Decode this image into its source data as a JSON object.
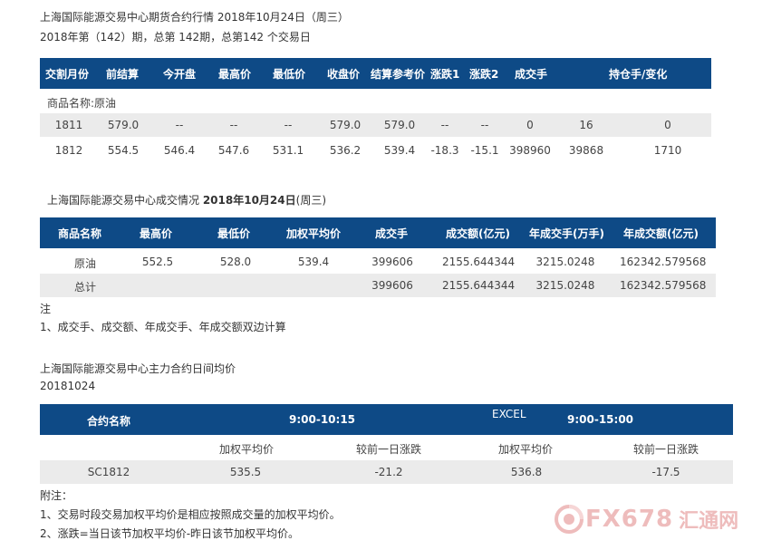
{
  "section1": {
    "title": "上海国际能源交易中心期货合约行情 2018年10月24日（周三）",
    "subtitle": "2018年第（142）期，总第 142期，总第142 个交易日",
    "headers": [
      "交割月份",
      "前结算",
      "今开盘",
      "最高价",
      "最低价",
      "收盘价",
      "结算参考价",
      "涨跌1",
      "涨跌2",
      "成交手",
      "持仓手/变化"
    ],
    "product_label": "商品名称:原油",
    "rows": [
      [
        "1811",
        "579.0",
        "--",
        "--",
        "--",
        "579.0",
        "579.0",
        "--",
        "--",
        "0",
        "16",
        "0"
      ],
      [
        "1812",
        "554.5",
        "546.4",
        "547.6",
        "531.1",
        "536.2",
        "539.4",
        "-18.3",
        "-15.1",
        "398960",
        "39868",
        "1710"
      ]
    ]
  },
  "section2": {
    "title_prefix": "上海国际能源交易中心成交情况 ",
    "title_date": "2018年10月24日",
    "title_suffix": "(周三)",
    "headers": [
      "商品名称",
      "最高价",
      "最低价",
      "加权平均价",
      "成交手",
      "成交额(亿元)",
      "年成交手(万手)",
      "年成交额(亿元)"
    ],
    "rows": [
      [
        "原油",
        "552.5",
        "528.0",
        "539.4",
        "399606",
        "2155.644344",
        "3215.0248",
        "162342.579568"
      ],
      [
        "总计",
        "",
        "",
        "",
        "399606",
        "2155.644344",
        "3215.0248",
        "162342.579568"
      ]
    ],
    "note_title": "注",
    "note_1": "1、成交手、成交额、年成交手、年成交额双边计算"
  },
  "section3": {
    "title": "上海国际能源交易中心主力合约日间均价",
    "date": "20181024",
    "headers": [
      "合约名称",
      "9:00-10:15",
      "EXCEL",
      "9:00-15:00"
    ],
    "subheaders": [
      "加权平均价",
      "较前一日涨跌",
      "加权平均价",
      "较前一日涨跌"
    ],
    "row": [
      "SC1812",
      "535.5",
      "-21.2",
      "536.8",
      "-17.5"
    ],
    "note_title": "附注：",
    "note_1": "1、交易时段交易加权平均价是相应按照成交量的加权平均价。",
    "note_2": "2、涨跌=当日该节加权平均价-昨日该节加权平均价。"
  },
  "watermark": {
    "brand": "FX678",
    "cn": "汇通网"
  },
  "colors": {
    "header": "#0e4a86",
    "row_grey": "#ebebeb"
  }
}
